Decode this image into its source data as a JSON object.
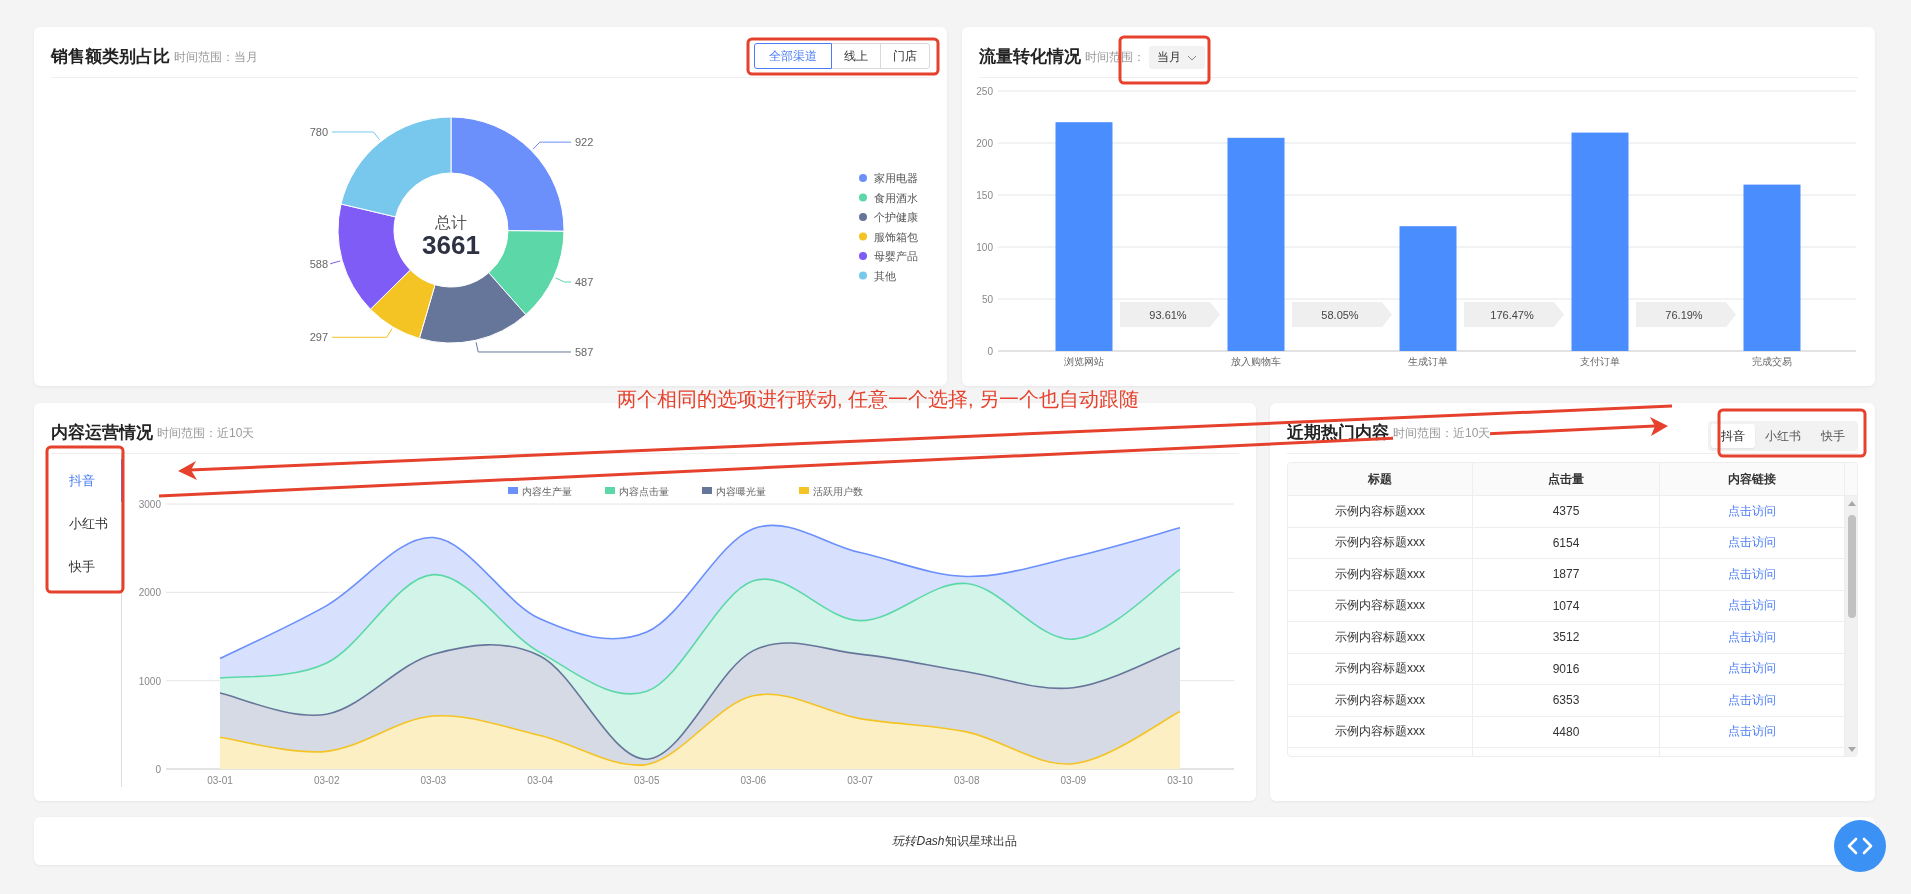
{
  "sales_card": {
    "title": "销售额类别占比",
    "subtitle": "时间范围：当月",
    "channel_tabs": [
      {
        "label": "全部渠道",
        "selected": true
      },
      {
        "label": "线上",
        "selected": false
      },
      {
        "label": "门店",
        "selected": false
      }
    ],
    "center_label": "总计",
    "center_value": "3661",
    "chart_data": {
      "type": "donut",
      "data_labels": true,
      "legend": "right",
      "categories": [
        "家用电器",
        "食用酒水",
        "个护健康",
        "服饰箱包",
        "母婴产品",
        "其他"
      ],
      "values": [
        922,
        487,
        587,
        297,
        588,
        780
      ],
      "colors": [
        "#6b8ffb",
        "#5cd8a8",
        "#66769a",
        "#f4c324",
        "#7e5cf5",
        "#78c8ee"
      ]
    }
  },
  "traffic_card": {
    "title": "流量转化情况",
    "subtitle": "时间范围：",
    "period_select": {
      "value": "当月"
    },
    "chart_data": {
      "type": "bar",
      "categories": [
        "浏览网站",
        "放入购物车",
        "生成订单",
        "支付订单",
        "完成交易"
      ],
      "values": [
        220,
        205,
        120,
        210,
        160
      ],
      "grid": true,
      "ylim": [
        0,
        250
      ],
      "yticks": [
        0,
        50,
        100,
        150,
        200,
        250
      ],
      "annotations": [
        "93.61%",
        "58.05%",
        "176.47%",
        "76.19%"
      ]
    }
  },
  "content_card": {
    "title": "内容运营情况",
    "subtitle": "时间范围：近10天",
    "platform_tabs": [
      {
        "label": "抖音",
        "selected": true
      },
      {
        "label": "小红书",
        "selected": false
      },
      {
        "label": "快手",
        "selected": false
      }
    ],
    "chart_data": {
      "type": "area",
      "x": [
        "03-01",
        "03-02",
        "03-03",
        "03-04",
        "03-05",
        "03-06",
        "03-07",
        "03-08",
        "03-09",
        "03-10"
      ],
      "ylim": [
        0,
        3000
      ],
      "yticks": [
        0,
        1000,
        2000,
        3000
      ],
      "grid": true,
      "legend": "top",
      "series": [
        {
          "name": "内容生产量",
          "color": "#6b8ffb",
          "values": [
            1250,
            1850,
            2620,
            1700,
            1550,
            2720,
            2450,
            2180,
            2400,
            2730
          ]
        },
        {
          "name": "内容点击量",
          "color": "#5cd8a8",
          "values": [
            1030,
            1200,
            2200,
            1320,
            880,
            2130,
            1680,
            2100,
            1470,
            2260
          ]
        },
        {
          "name": "内容曝光量",
          "color": "#66769a",
          "values": [
            860,
            620,
            1300,
            1280,
            110,
            1340,
            1300,
            1100,
            920,
            1370
          ]
        },
        {
          "name": "活跃用户数",
          "color": "#f4c324",
          "values": [
            360,
            200,
            600,
            380,
            50,
            830,
            570,
            420,
            60,
            650
          ]
        }
      ]
    }
  },
  "hot_card": {
    "title": "近期热门内容",
    "subtitle": "时间范围：近10天",
    "platform_tabs": [
      {
        "label": "抖音",
        "selected": true
      },
      {
        "label": "小红书",
        "selected": false
      },
      {
        "label": "快手",
        "selected": false
      }
    ],
    "table": {
      "columns": [
        "标题",
        "点击量",
        "内容链接"
      ],
      "rows": [
        [
          "示例内容标题xxx",
          "4375",
          "点击访问"
        ],
        [
          "示例内容标题xxx",
          "6154",
          "点击访问"
        ],
        [
          "示例内容标题xxx",
          "1877",
          "点击访问"
        ],
        [
          "示例内容标题xxx",
          "1074",
          "点击访问"
        ],
        [
          "示例内容标题xxx",
          "3512",
          "点击访问"
        ],
        [
          "示例内容标题xxx",
          "9016",
          "点击访问"
        ],
        [
          "示例内容标题xxx",
          "6353",
          "点击访问"
        ],
        [
          "示例内容标题xxx",
          "4480",
          "点击访问"
        ]
      ]
    }
  },
  "footer": {
    "brand": "玩转Dash",
    "text": "知识星球出品"
  },
  "annotation": {
    "text": "两个相同的选项进行联动, 任意一个选择, 另一个也自动跟随"
  }
}
